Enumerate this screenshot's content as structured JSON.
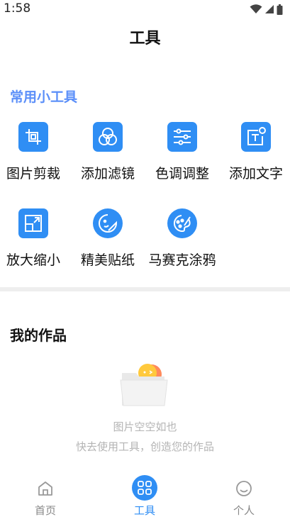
{
  "status_bar": {
    "time": "1:58"
  },
  "header": {
    "title": "工具"
  },
  "tools_section": {
    "title": "常用小工具",
    "items": [
      {
        "label": "图片剪裁",
        "icon": "crop-icon"
      },
      {
        "label": "添加滤镜",
        "icon": "filter-icon"
      },
      {
        "label": "色调调整",
        "icon": "adjust-sliders-icon"
      },
      {
        "label": "添加文字",
        "icon": "add-text-icon"
      },
      {
        "label": "放大缩小",
        "icon": "resize-icon"
      },
      {
        "label": "精美贴纸",
        "icon": "sticker-icon"
      },
      {
        "label": "马赛克涂鸦",
        "icon": "palette-icon"
      }
    ]
  },
  "works_section": {
    "title": "我的作品",
    "empty_line1": "图片空空如也",
    "empty_line2": "快去使用工具，创造您的作品"
  },
  "bottom_nav": {
    "items": [
      {
        "label": "首页",
        "icon": "home-icon",
        "active": false
      },
      {
        "label": "工具",
        "icon": "grid-icon",
        "active": true
      },
      {
        "label": "个人",
        "icon": "smiley-icon",
        "active": false
      }
    ]
  },
  "colors": {
    "accent": "#2f8ef4",
    "section_title": "#5b8ff9",
    "muted_text": "#b4b4b4"
  }
}
